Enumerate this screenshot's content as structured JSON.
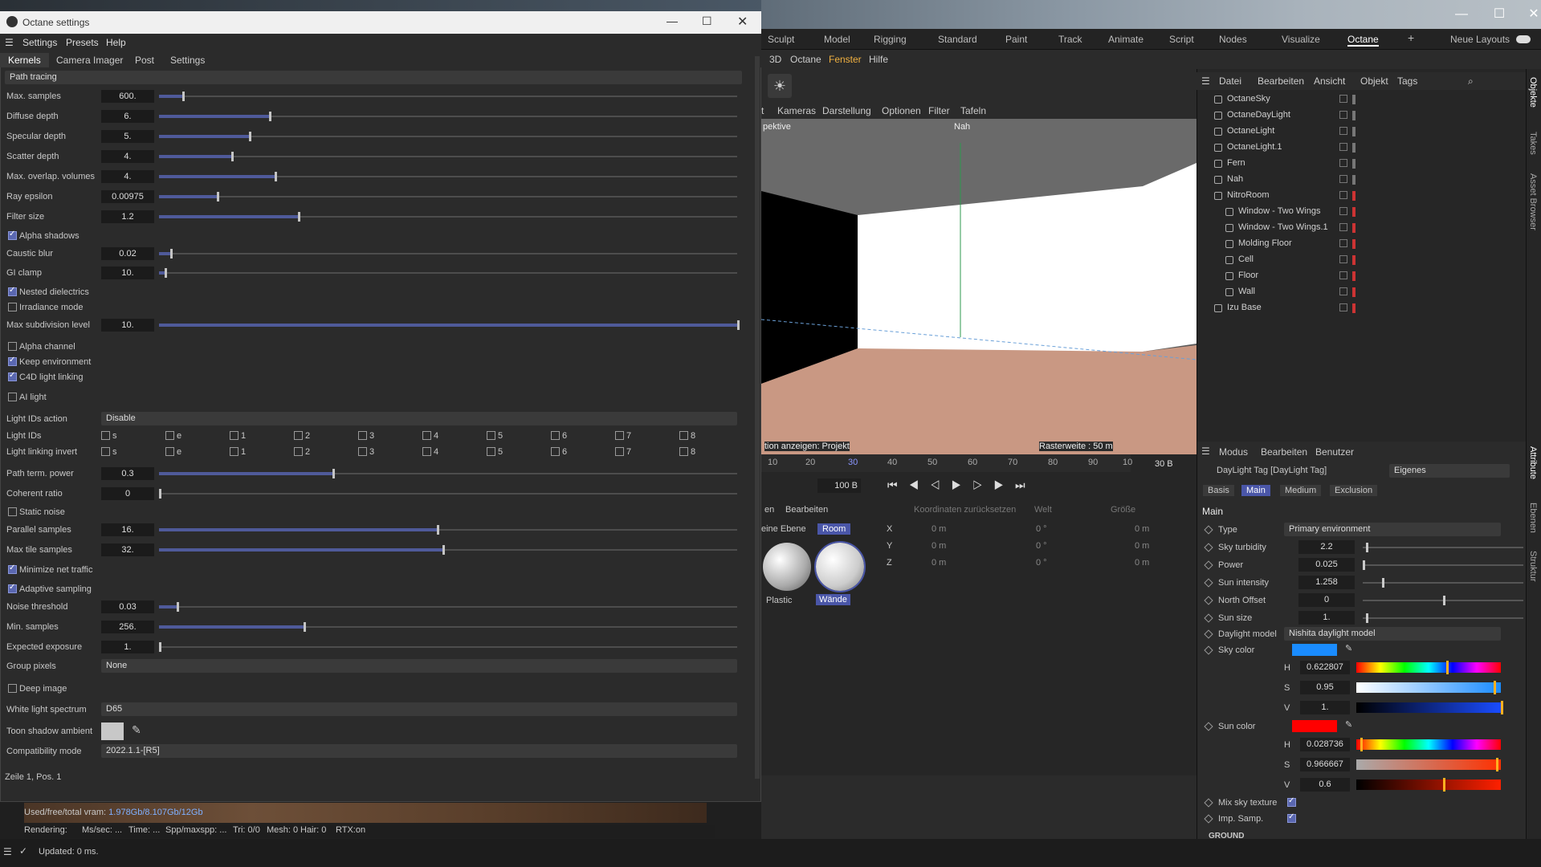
{
  "octane_window": {
    "title": "Octane settings",
    "menu": [
      "Settings",
      "Presets",
      "Help"
    ],
    "tabs": [
      "Kernels",
      "Camera Imager",
      "Post",
      "Settings"
    ],
    "kernel": "Path tracing",
    "sliders": [
      {
        "label": "Max. samples",
        "value": "600.",
        "fraction": 0.04
      },
      {
        "label": "Diffuse depth",
        "value": "6.",
        "fraction": 0.19
      },
      {
        "label": "Specular depth",
        "value": "5.",
        "fraction": 0.155
      },
      {
        "label": "Scatter depth",
        "value": "4.",
        "fraction": 0.125
      },
      {
        "label": "Max. overlap. volumes",
        "value": "4.",
        "fraction": 0.2
      },
      {
        "label": "Ray epsilon",
        "value": "0.00975",
        "fraction": 0.1
      },
      {
        "label": "Filter size",
        "value": "1.2",
        "fraction": 0.24
      }
    ],
    "alpha_shadows": "Alpha shadows",
    "caustic": {
      "label": "Caustic blur",
      "value": "0.02",
      "fraction": 0.02
    },
    "giclamp": {
      "label": "GI clamp",
      "value": "10.",
      "fraction": 0.01
    },
    "nested": "Nested dielectrics",
    "irradiance": "Irradiance mode",
    "maxsub": {
      "label": "Max subdivision level",
      "value": "10.",
      "fraction": 1.0
    },
    "alpha_channel": "Alpha channel",
    "keep_env": "Keep environment",
    "c4d_link": "C4D light linking",
    "ai_light": "AI light",
    "light_ids_action": {
      "label": "Light IDs action",
      "value": "Disable"
    },
    "light_ids": "Light IDs",
    "light_link_invert": "Light linking invert",
    "id_opts": [
      "s",
      "e",
      "1",
      "2",
      "3",
      "4",
      "5",
      "6",
      "7",
      "8"
    ],
    "path_term": {
      "label": "Path term. power",
      "value": "0.3",
      "fraction": 0.3
    },
    "coherent": {
      "label": "Coherent ratio",
      "value": "0",
      "fraction": 0.0
    },
    "static_noise": "Static noise",
    "parallel": {
      "label": "Parallel samples",
      "value": "16.",
      "fraction": 0.48
    },
    "max_tile": {
      "label": "Max tile samples",
      "value": "32.",
      "fraction": 0.49
    },
    "min_net": "Minimize net traffic",
    "adaptive": "Adaptive sampling",
    "noise": {
      "label": "Noise threshold",
      "value": "0.03",
      "fraction": 0.03
    },
    "min_samples": {
      "label": "Min. samples",
      "value": "256.",
      "fraction": 0.25
    },
    "exposure": {
      "label": "Expected exposure",
      "value": "1.",
      "fraction": 0.0
    },
    "group_pixels": {
      "label": "Group pixels",
      "value": "None"
    },
    "deep_image": "Deep image",
    "white_light": {
      "label": "White light spectrum",
      "value": "D65"
    },
    "toon": "Toon shadow ambient",
    "compat": {
      "label": "Compatibility mode",
      "value": "2022.1.1-[R5]"
    },
    "status": "Zeile 1, Pos. 1"
  },
  "layouts": [
    "Sculpt",
    "Model",
    "Rigging",
    "Standard",
    "Paint",
    "Track",
    "Animate",
    "Script",
    "Nodes",
    "Visualize",
    "Octane",
    "Neue Layouts"
  ],
  "menu2": [
    "3D",
    "Octane",
    "Fenster",
    "Hilfe"
  ],
  "vp_menu": [
    "t",
    "Kameras",
    "Darstellung",
    "Optionen",
    "Filter",
    "Tafeln"
  ],
  "vp_labels": {
    "persp": "pektive",
    "cam": "Nah",
    "grid": "Rasterweite : 50 m",
    "proj": "tion anzeigen: Projekt"
  },
  "timeline": {
    "ticks": [
      "10",
      "20",
      "30",
      "40",
      "50",
      "60",
      "70",
      "80",
      "90",
      "10"
    ],
    "frame": "30 B",
    "end": "100 B"
  },
  "objman": {
    "menu": [
      "Datei",
      "Bearbeiten",
      "Ansicht",
      "Objekt",
      "Tags"
    ],
    "rows": [
      "OctaneSky",
      "OctaneDayLight",
      "OctaneLight",
      "OctaneLight.1",
      "Fern",
      "Nah",
      "NitroRoom",
      "Window - Two Wings",
      "Window - Two Wings.1",
      "Molding Floor",
      "Cell",
      "Floor",
      "Wall",
      "Izu Base"
    ]
  },
  "attr": {
    "menu": [
      "Modus",
      "Bearbeiten",
      "Benutzer"
    ],
    "title": "DayLight Tag [DayLight Tag]",
    "preset": "Eigenes",
    "tabs": [
      "Basis",
      "Main",
      "Medium",
      "Exclusion"
    ],
    "section": "Main",
    "type": {
      "label": "Type",
      "value": "Primary environment"
    },
    "rows": [
      {
        "label": "Sky turbidity",
        "value": "2.2",
        "fraction": 0.02
      },
      {
        "label": "Power",
        "value": "0.025",
        "fraction": 0.0
      },
      {
        "label": "Sun intensity",
        "value": "1.258",
        "fraction": 0.12
      },
      {
        "label": "North Offset",
        "value": "0",
        "fraction": 0.5
      },
      {
        "label": "Sun size",
        "value": "1.",
        "fraction": 0.02
      }
    ],
    "daylight_model": {
      "label": "Daylight model",
      "value": "Nishita daylight model"
    },
    "sky_color": {
      "label": "Sky color",
      "color": "#1a8cff",
      "H": "0.622807",
      "S": "0.95",
      "V": "1."
    },
    "sun_color": {
      "label": "Sun color",
      "color": "#ff0000",
      "H": "0.028736",
      "S": "0.966667",
      "V": "0.6"
    },
    "mix_sky": "Mix sky texture",
    "imp_samp": "Imp. Samp.",
    "ground": "GROUND"
  },
  "materials": {
    "tabs": [
      "en",
      "Bearbeiten"
    ],
    "layers": [
      "eine Ebene",
      "Room"
    ],
    "names": [
      "Plastic",
      "Wände"
    ]
  },
  "coords": {
    "reset": "Koordinaten zurücksetzen",
    "welt": "Welt",
    "groesse": "Größe",
    "axes": [
      "X",
      "Y",
      "Z"
    ],
    "val": "0 m",
    "deg": "0 °"
  },
  "render_info": {
    "vram_label": "Used/free/total vram:",
    "vram": "1.978Gb/8.107Gb/12Gb",
    "rendering": "Rendering:",
    "ms": "Ms/sec: ...",
    "time": "Time: ...",
    "spp": "Spp/maxspp: ...",
    "tri": "Tri: 0/0",
    "mesh": "Mesh: 0",
    "hair": "Hair: 0",
    "rtx": "RTX:on"
  },
  "status_bottom": "Updated: 0 ms.",
  "right_tabs": [
    "Objekte",
    "Takes",
    "Asset Browser",
    "Attribute",
    "Ebenen",
    "Struktur"
  ]
}
